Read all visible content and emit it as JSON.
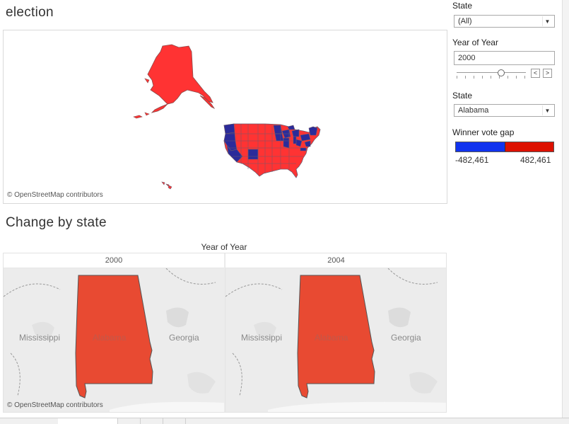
{
  "dashboard": {
    "title_election": "election",
    "title_change": "Change by state"
  },
  "map": {
    "credit": "© OpenStreetMap contributors",
    "colors": {
      "dem": "#2b2b9a",
      "rep": "#ff3333",
      "border": "#6d5a6d"
    }
  },
  "filters": {
    "state_filter": {
      "label": "State",
      "value": "(All)"
    },
    "year_filter": {
      "label": "Year of Year",
      "value": "2000"
    },
    "state_param": {
      "label": "State",
      "value": "Alabama"
    }
  },
  "legend": {
    "title": "Winner vote gap",
    "min": "-482,461",
    "max": "482,461",
    "colors": {
      "low": "#1133ee",
      "high": "#dd1100"
    }
  },
  "change_chart": {
    "header": "Year of Year",
    "columns": [
      "2000",
      "2004"
    ],
    "labels": {
      "left": "Mississippi",
      "center": "Alabama",
      "right": "Georgia"
    },
    "credit": "© OpenStreetMap contributors",
    "fill": "#e84a32"
  }
}
